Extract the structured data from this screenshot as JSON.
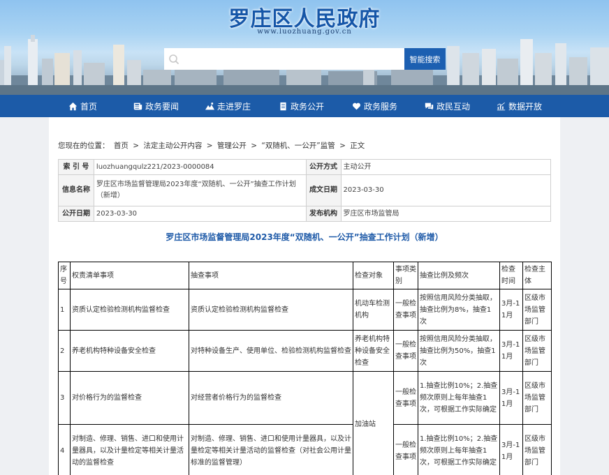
{
  "site": {
    "title": "罗庄区人民政府",
    "url": "www.luozhuang.gov.cn",
    "search_placeholder": "",
    "search_button": "智能搜索"
  },
  "colors": {
    "nav_bg": "#1c5ba8",
    "title_blue": "#1e5aa8",
    "search_button": "#1c5fb1"
  },
  "nav": [
    {
      "label": "首页",
      "icon": "home-icon"
    },
    {
      "label": "政务要闻",
      "icon": "news-icon"
    },
    {
      "label": "走进罗庄",
      "icon": "landscape-icon"
    },
    {
      "label": "政务公开",
      "icon": "document-icon"
    },
    {
      "label": "政务服务",
      "icon": "heart-icon"
    },
    {
      "label": "政民互动",
      "icon": "chat-icon"
    },
    {
      "label": "数据开放",
      "icon": "chart-icon"
    }
  ],
  "breadcrumb": {
    "prefix": "您现在的位置：",
    "items": [
      "首页",
      "法定主动公开内容",
      "管理公开",
      "“双随机、一公开”监管",
      "正文"
    ],
    "sep": ">"
  },
  "meta": {
    "index_label": "索 引 号",
    "index_value": "luozhuangqulz221/2023-0000084",
    "mode_label": "公开方式",
    "mode_value": "主动公开",
    "name_label": "信息名称",
    "name_value": "罗庄区市场监督管理局2023年度“双随机、一公开”抽查工作计划（新增）",
    "created_label": "成文日期",
    "created_value": "2023-03-30",
    "pub_label": "公开日期",
    "pub_value": "2023-03-30",
    "org_label": "发布机构",
    "org_value": "罗庄区市场监管局"
  },
  "doc_title": "罗庄区市场监督管理局2023年度“双随机、一公开”抽查工作计划（新增）",
  "plan": {
    "headers": [
      "序号",
      "权责清单事项",
      "抽查事项",
      "检查对象",
      "事项类别",
      "抽查比例及频次",
      "检查时间",
      "检查主体"
    ],
    "rows": [
      [
        "1",
        "资质认定检验检测机构监督检查",
        "资质认定检验检测机构监督检查",
        "机动车检测机构",
        "一般检查事项",
        "按照信用风险分类抽取，抽查比例为8%，抽查1次",
        "3月-11月",
        "区级市场监管部门"
      ],
      [
        "2",
        "养老机构特种设备安全检查",
        "对特种设备生产、使用单位、检验检测机构监督检查",
        "养老机构特种设备安全检查",
        "一般检查事项",
        "按照信用风险分类抽取，抽查比例为50%，抽查1次",
        "3月-11月",
        "区级市场监管部门"
      ],
      [
        "3",
        "对价格行为的监督检查",
        "对经营者价格行为的监督检查",
        "加油站",
        "一般检查事项",
        "1.抽查比例10%；2.抽查频次原则上每年抽查1次，可根据工作实际确定",
        "3月-11月",
        "区级市场监管部门"
      ],
      [
        "4",
        "对制造、修理、销售、进口和使用计量器具，以及计量检定等相关计量活动的监督检查",
        "对制造、修理、销售、进口和使用计量器具，以及计量检定等相关计量活动的监督检查（对社会公用计量标准的监督管理）",
        "",
        "一般检查事项",
        "1.抽查比例10%；2.抽查频次原则上每年抽查1次，可根据工作实际确定",
        "3月-11月",
        "区级市场监管部门"
      ]
    ]
  }
}
